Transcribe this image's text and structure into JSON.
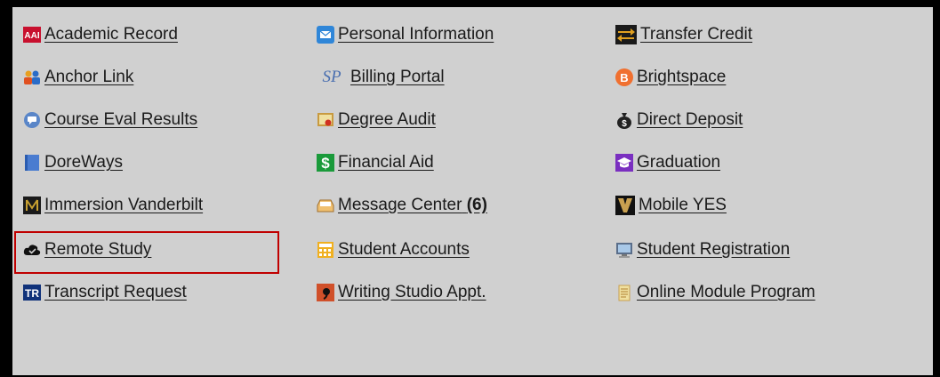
{
  "links": {
    "col1": [
      {
        "label": "Academic Record",
        "icon": "aai-icon"
      },
      {
        "label": "Anchor Link",
        "icon": "people-icon"
      },
      {
        "label": "Course Eval Results",
        "icon": "chat-icon"
      },
      {
        "label": "DoreWays",
        "icon": "book-icon"
      },
      {
        "label": "Immersion Vanderbilt",
        "icon": "iv-logo-icon"
      },
      {
        "label": "Remote Study",
        "icon": "cloud-icon"
      },
      {
        "label": "Transcript Request",
        "icon": "tr-icon"
      }
    ],
    "col2": [
      {
        "label": "Personal Information",
        "icon": "envelope-icon"
      },
      {
        "label": "Billing Portal",
        "icon": "sp-icon"
      },
      {
        "label": "Degree Audit",
        "icon": "certificate-icon"
      },
      {
        "label": "Financial Aid",
        "icon": "dollar-icon"
      },
      {
        "label": "Message Center",
        "count": "(6)",
        "icon": "inbox-icon"
      },
      {
        "label": "Student Accounts",
        "icon": "calculator-icon"
      },
      {
        "label": "Writing Studio Appt.",
        "icon": "writing-studio-icon"
      }
    ],
    "col3": [
      {
        "label": "Transfer Credit",
        "icon": "transfer-arrows-icon"
      },
      {
        "label": "Brightspace",
        "icon": "brightspace-icon"
      },
      {
        "label": "Direct Deposit",
        "icon": "money-bag-icon"
      },
      {
        "label": "Graduation",
        "icon": "grad-cap-icon"
      },
      {
        "label": "Mobile YES",
        "icon": "vanderbilt-v-icon"
      },
      {
        "label": "Student Registration",
        "icon": "monitor-icon"
      },
      {
        "label": "Online Module Program",
        "icon": "notepad-icon"
      }
    ]
  },
  "icon_text": {
    "aai": "AAI",
    "sp": "SP",
    "tr": "TR",
    "dollar": "$",
    "brightspace": "B"
  },
  "colors": {
    "highlight": "#c00000",
    "panel": "#d0d0d0"
  }
}
